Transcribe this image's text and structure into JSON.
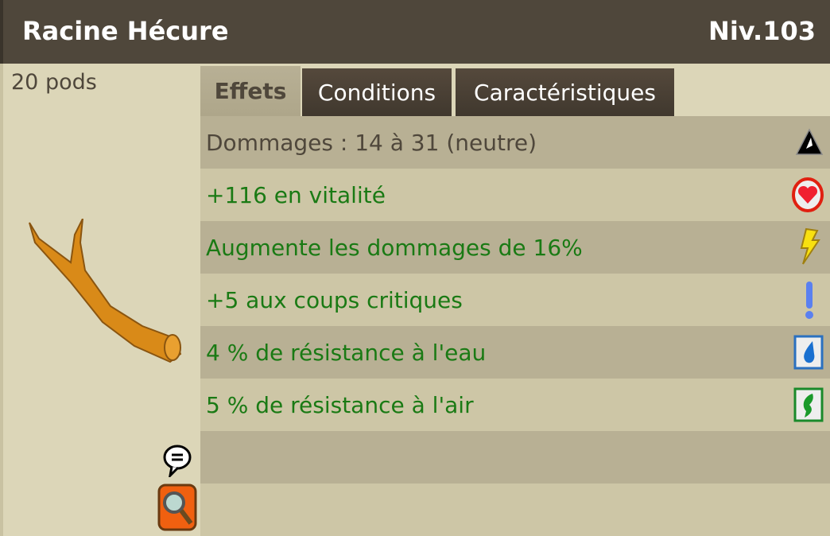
{
  "item": {
    "name": "Racine Hécure",
    "level": "Niv.103",
    "weight": "20 pods"
  },
  "tabs": [
    {
      "label": "Effets"
    },
    {
      "label": "Conditions"
    },
    {
      "label": "Caractéristiques"
    }
  ],
  "effects": [
    {
      "text": "Dommages : 14 à 31 (neutre)",
      "icon": "neutral-icon"
    },
    {
      "text": "+116 en vitalité",
      "icon": "heart-icon"
    },
    {
      "text": "Augmente les dommages de 16%",
      "icon": "lightning-icon"
    },
    {
      "text": "+5 aux coups critiques",
      "icon": "exclamation-icon"
    },
    {
      "text": "4 % de résistance à l'eau",
      "icon": "water-drop-icon"
    },
    {
      "text": "5 % de résistance à l'air",
      "icon": "air-icon"
    }
  ],
  "colors": {
    "header": "#4f473b",
    "effect_text": "#1a7a14"
  }
}
